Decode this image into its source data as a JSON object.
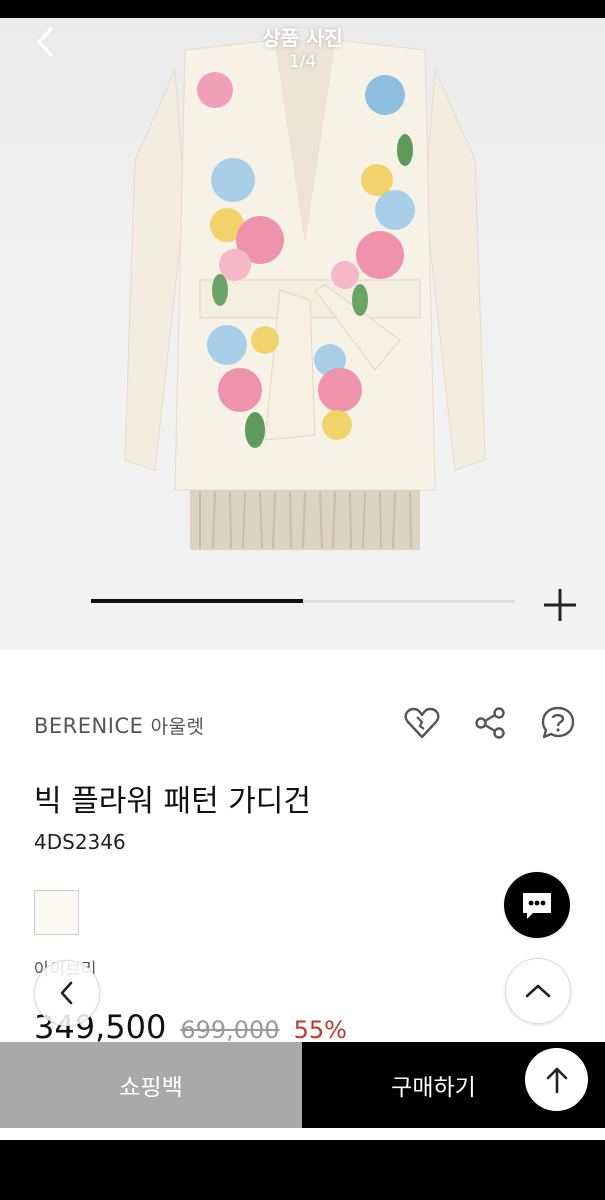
{
  "header": {
    "title": "상품 사진",
    "counter": "1/4"
  },
  "gallery": {
    "progress": 0.5
  },
  "product": {
    "brand": "BERENICE",
    "outlet": "아울렛",
    "name": "빅 플라워 패턴 가디건",
    "code": "4DS2346",
    "color_name": "아이브리",
    "swatch_color": "#fbf9f3",
    "price": "349,500",
    "original_price": "699,000",
    "discount": "55%"
  },
  "actions": {
    "bag_label": "쇼핑백",
    "buy_label": "구매하기"
  },
  "icons": [
    "back-icon",
    "zoom-plus-icon",
    "heart-icon",
    "share-icon",
    "question-icon",
    "chat-icon",
    "chevron-left-icon",
    "chevron-up-icon",
    "arrow-up-icon"
  ],
  "colors": {
    "discount": "#c0392b",
    "bag_button": "#a9a9a9",
    "buy_button": "#000000"
  }
}
